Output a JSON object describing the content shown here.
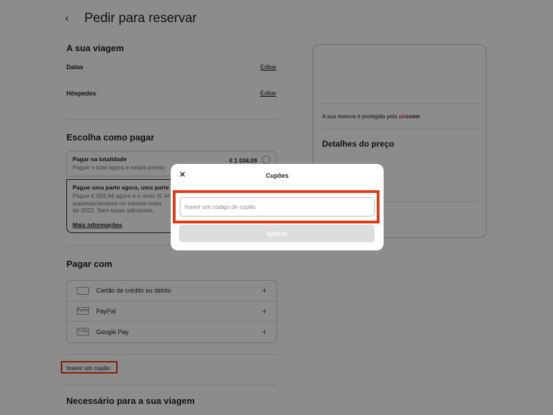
{
  "header": {
    "back_icon": "‹",
    "title": "Pedir para reservar"
  },
  "trip": {
    "title": "A sua viagem",
    "dates_label": "Datas",
    "dates_edit": "Editar",
    "guests_label": "Hóspedes",
    "guests_edit": "Editar"
  },
  "payment_choice": {
    "title": "Escolha como pagar",
    "full": {
      "title": "Pagar na totalidade",
      "subtitle": "Pague o total agora e estará pronto",
      "price": "€ 1 034,09"
    },
    "partial": {
      "title": "Pague uma parte agora, uma parte",
      "line1": "Pague € 593,54 agora e o resto (€ 44",
      "line2": "automaticamente no mesmo méto",
      "line3": "de 2022. Sem taxas adicionais.",
      "more_link": "Mais informações"
    }
  },
  "pay_with": {
    "title": "Pagar com",
    "methods": [
      {
        "label": "Cartão de crédito ou débito",
        "icon": "credit-card-icon",
        "badge": ""
      },
      {
        "label": "PayPal",
        "icon": "paypal-icon",
        "badge": "PayPal"
      },
      {
        "label": "Google Pay",
        "icon": "google-pay-icon",
        "badge": "G Pay"
      }
    ]
  },
  "coupon_link": "Inserir um cupão",
  "required_section": {
    "title": "Necessário para a sua viagem"
  },
  "sidebar": {
    "protect_text": "A sua reserva é protegida pela",
    "brand_air": "air",
    "brand_cover": "cover",
    "price_title": "Detalhes do preço"
  },
  "modal": {
    "close_icon": "✕",
    "title": "Cupões",
    "input_placeholder": "Inserir um código de cupão",
    "input_value": "",
    "apply_label": "Aplicar"
  },
  "colors": {
    "highlight": "#e33a14",
    "brand": "#e0345a",
    "apply_disabled": "#dddddd",
    "overlay": "rgba(0,0,0,0.45)"
  }
}
